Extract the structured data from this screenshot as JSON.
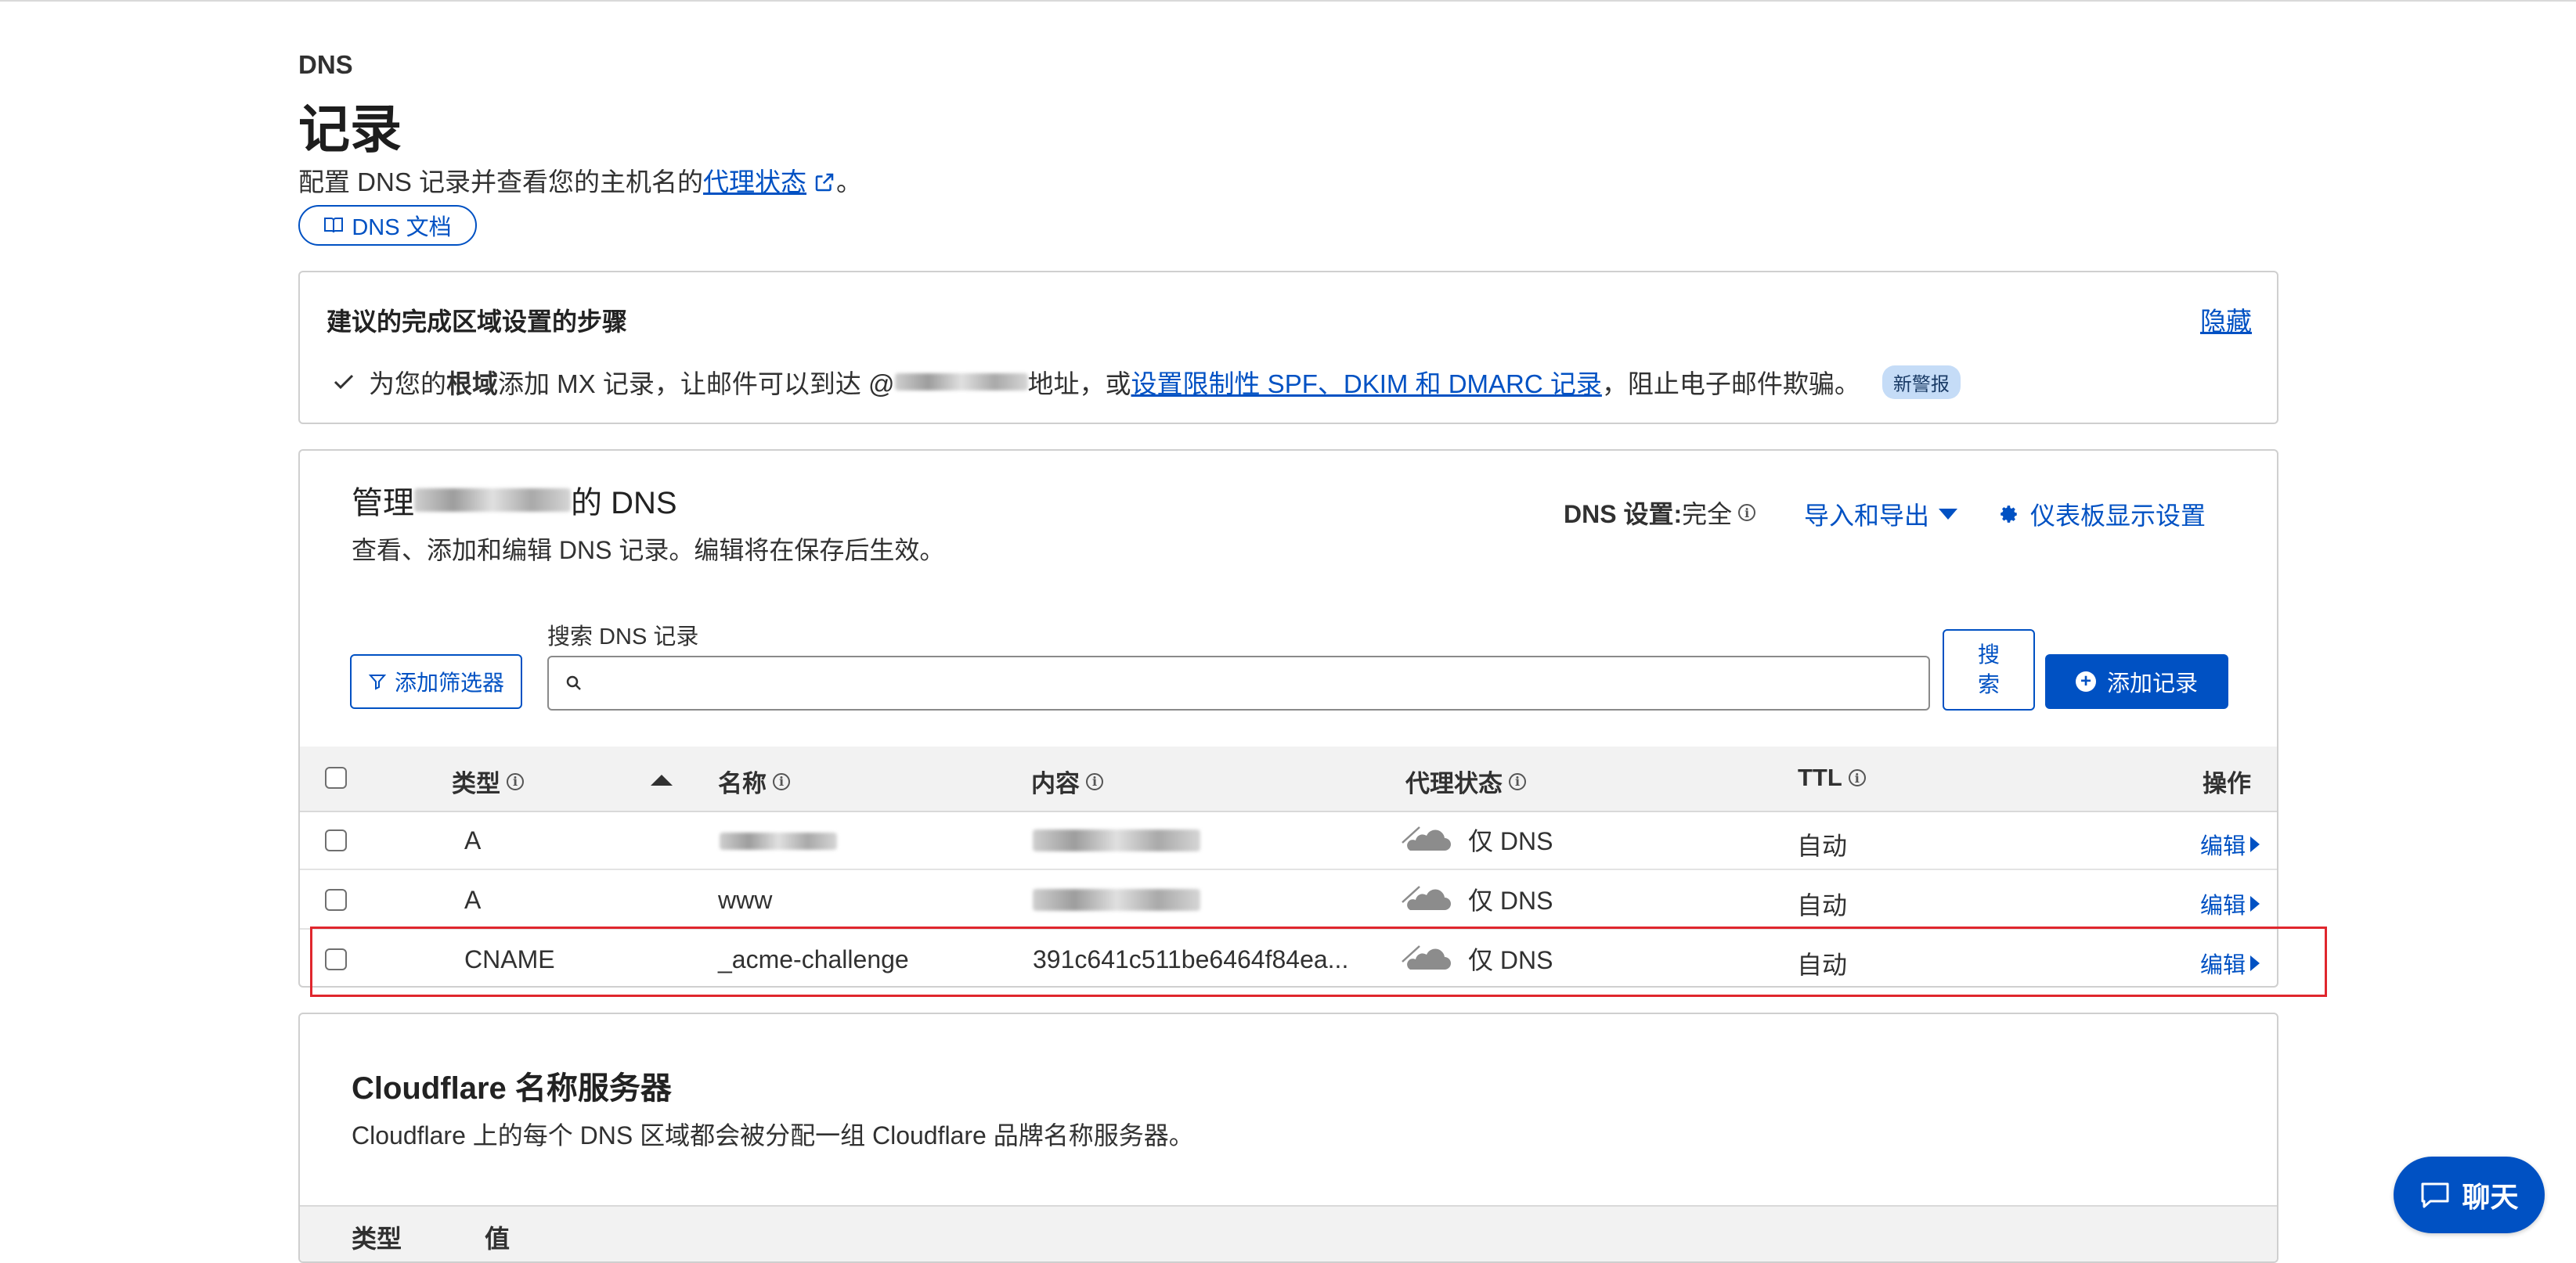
{
  "header": {
    "eyebrow": "DNS",
    "title": "记录",
    "subtitle_prefix": "配置 DNS 记录并查看您的主机名的",
    "subtitle_link": "代理状态",
    "subtitle_suffix": "。",
    "docs_button": "DNS 文档"
  },
  "recommendations": {
    "title": "建议的完成区域设置的步骤",
    "hide": "隐藏",
    "item": {
      "part1": "为您的",
      "bold": "根域",
      "part2": "添加 MX 记录，让邮件可以到达 @",
      "part3": " 地址，或",
      "link": "设置限制性 SPF、DKIM 和 DMARC 记录",
      "part4": "，阻止电子邮件欺骗。",
      "badge": "新警报"
    }
  },
  "manage": {
    "title_prefix": "管理",
    "title_suffix": " 的 DNS",
    "description": "查看、添加和编辑 DNS 记录。编辑将在保存后生效。",
    "settings_label": "DNS 设置:",
    "settings_value": "完全",
    "import_export": "导入和导出",
    "dashboard_settings": "仪表板显示设置",
    "filter_button": "添加筛选器",
    "search_label": "搜索 DNS 记录",
    "search_value": "",
    "search_button": "搜\n索",
    "add_record": "添加记录",
    "columns": {
      "type": "类型",
      "name": "名称",
      "content": "内容",
      "proxy": "代理状态",
      "ttl": "TTL",
      "actions": "操作"
    },
    "rows": [
      {
        "type": "A",
        "name": "",
        "content": "",
        "proxy": "仅 DNS",
        "ttl": "自动",
        "action": "编辑"
      },
      {
        "type": "A",
        "name": "www",
        "content": "",
        "proxy": "仅 DNS",
        "ttl": "自动",
        "action": "编辑"
      },
      {
        "type": "CNAME",
        "name": "_acme-challenge",
        "content": "391c641c511be6464f84ea...",
        "proxy": "仅 DNS",
        "ttl": "自动",
        "action": "编辑"
      }
    ]
  },
  "nameservers": {
    "title": "Cloudflare 名称服务器",
    "description": "Cloudflare 上的每个 DNS 区域都会被分配一组 Cloudflare 品牌名称服务器。",
    "col_type": "类型",
    "col_value": "值"
  },
  "chat": {
    "label": "聊天"
  },
  "colors": {
    "accent": "#0051c3",
    "highlight": "#e0262d",
    "badge_bg": "#c5dcf7"
  },
  "icons": [
    "external-link-icon",
    "book-icon",
    "check-icon",
    "info-icon",
    "caret-down-icon",
    "gear-icon",
    "filter-icon",
    "search-icon",
    "plus-circle-icon",
    "sort-asc-icon",
    "cloud-dns-only-icon",
    "caret-right-icon",
    "chat-icon"
  ]
}
